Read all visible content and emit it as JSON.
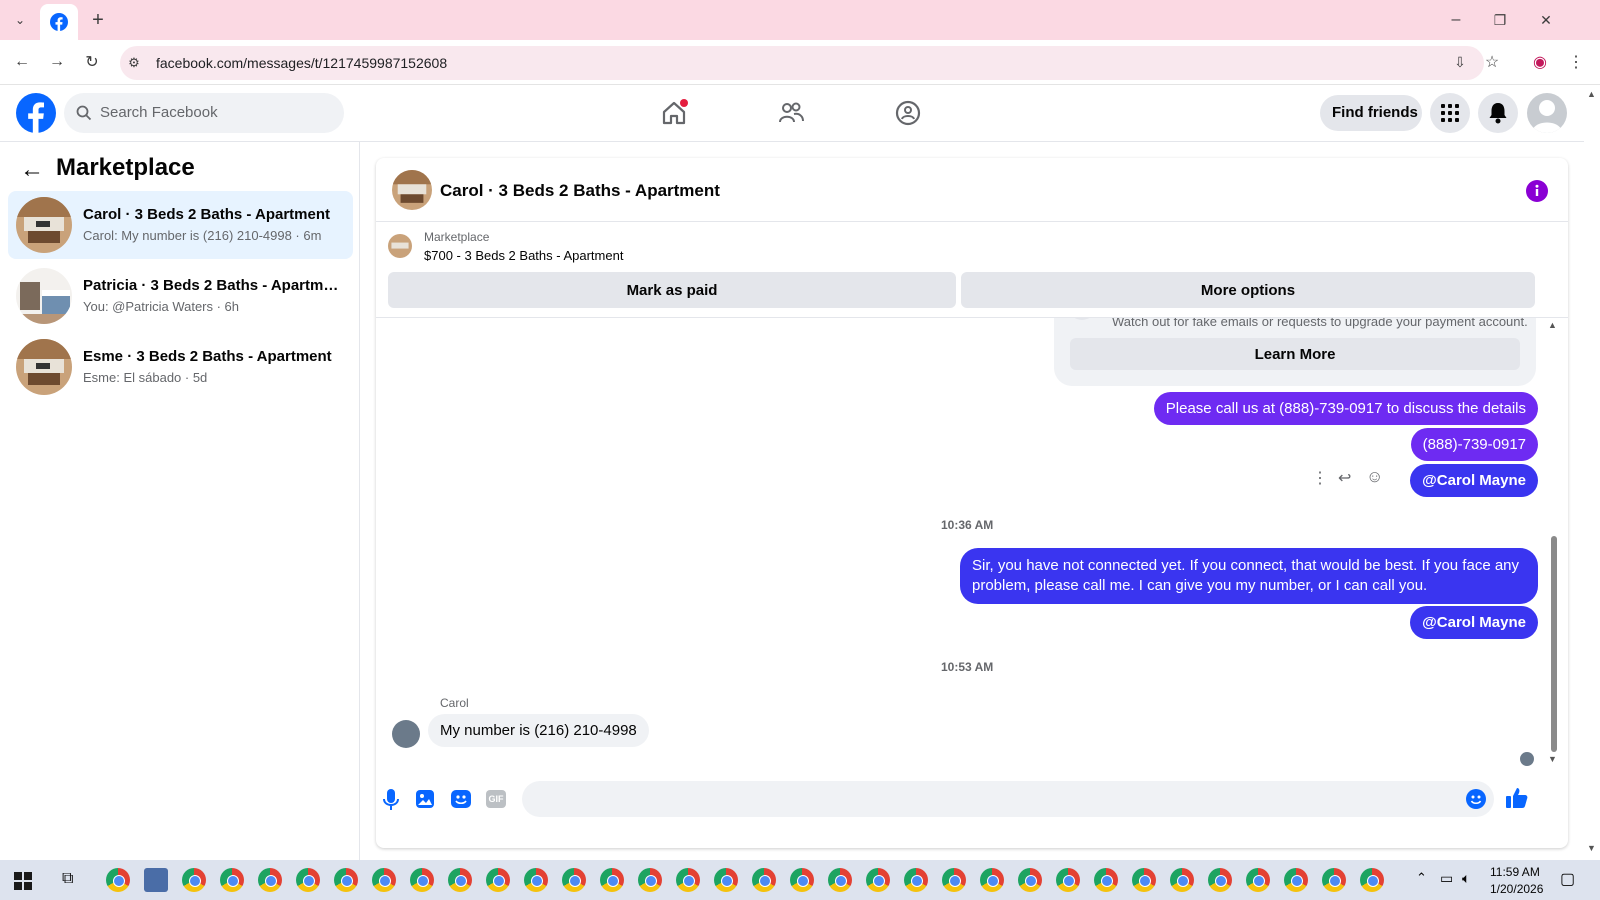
{
  "browser": {
    "url": "facebook.com/messages/t/1217459987152608",
    "new_tab": "+",
    "win_min": "–",
    "win_max": "❐",
    "win_close": "✕"
  },
  "header": {
    "search_placeholder": "Search Facebook",
    "find_friends": "Find friends"
  },
  "sidebar": {
    "title": "Marketplace",
    "conversations": [
      {
        "title": "Carol · 3 Beds 2 Baths - Apartment",
        "subtitle": "Carol: My number is (216) 210-4998 · 6m",
        "selected": true
      },
      {
        "title": "Patricia · 3 Beds 2 Baths - Apartme...",
        "subtitle": "You: @Patricia Waters · 6h",
        "selected": false
      },
      {
        "title": "Esme · 3 Beds 2 Baths - Apartment",
        "subtitle": "Esme: El sábado · 5d",
        "selected": false
      }
    ]
  },
  "chat": {
    "title": "Carol · 3 Beds 2 Baths - Apartment",
    "listing_source": "Marketplace",
    "listing_title": "$700 - 3 Beds 2 Baths - Apartment",
    "mark_paid": "Mark as paid",
    "more_options": "More options",
    "warning_text": "Watch out for fake emails or requests to upgrade your payment account.",
    "learn_more": "Learn More",
    "messages": {
      "m1": "Please call us at (888)-739-0917  to discuss  the details",
      "m2": "(888)-739-0917",
      "m3": "@Carol Mayne",
      "ts1": "10:36 AM",
      "m4": "Sir, you have not connected yet. If you connect, that would be best. If you face any problem, please call me. I can give you my number, or I can call you.",
      "m5": "@Carol Mayne",
      "ts2": "10:53 AM",
      "sender": "Carol",
      "m6": "My number is (216) 210-4998"
    },
    "gif_label": "GIF"
  },
  "taskbar": {
    "time": "11:59 AM",
    "date": "1/20/2026"
  },
  "colors": {
    "fb_blue": "#0866ff",
    "purple": "#6e2bf2",
    "blue_bubble": "#3a35f0"
  }
}
